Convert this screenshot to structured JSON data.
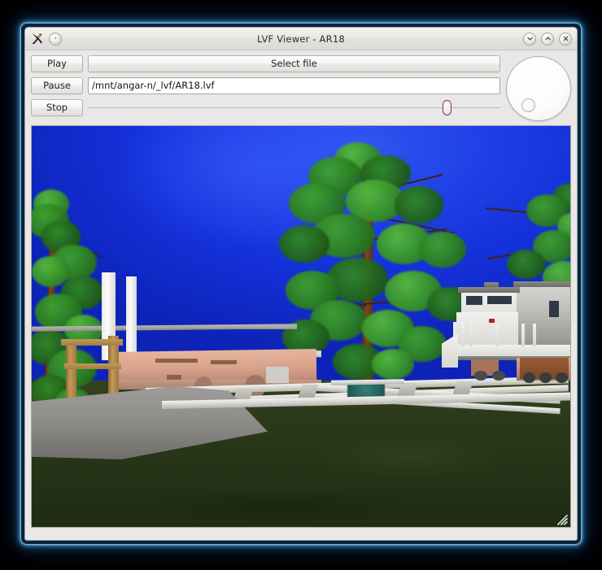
{
  "window": {
    "title": "LVF Viewer - AR18",
    "app_icon": "x-logo-icon",
    "menu_button": "window-menu-icon",
    "controls": {
      "minimize": "chevron-down-icon",
      "maximize": "chevron-up-icon",
      "close": "close-x-icon"
    }
  },
  "toolbar": {
    "play_label": "Play",
    "pause_label": "Pause",
    "stop_label": "Stop",
    "select_file_label": "Select file",
    "file_path_value": "/mnt/angar-n/_lvf/AR18.lvf",
    "file_path_placeholder": "",
    "seek_slider": {
      "name": "seek-slider",
      "value_percent": 88
    },
    "dial": {
      "name": "rotation-dial",
      "indicator_angle_deg": 215
    }
  },
  "viewport": {
    "name": "3d-scene-viewport",
    "description": "Rendered 3D railway scene: blue sky, green trees, white signal posts, gray diesel locomotive with yellow radiator grilles, salmon flatcar, white rails with a switch, dark green grass and a gray gravel pad",
    "colors": {
      "sky": "#1430d8",
      "sky_highlight": "#2f55f0",
      "grass": "#2c3a1b",
      "rail": "#e8e8e4",
      "gravel": "#8f8e8a",
      "locomotive_body": "#b9b9b5",
      "locomotive_tank": "#c08e76",
      "flatcar": "#d9a38c",
      "grille": "#c8a327",
      "foliage": "#2e8423",
      "trunk": "#7a4526",
      "switch_mechanism": "#235c57",
      "wood_post": "#c49a56"
    }
  },
  "desktop": {
    "background": "#000000",
    "window_glow": "#5ab4f0"
  }
}
